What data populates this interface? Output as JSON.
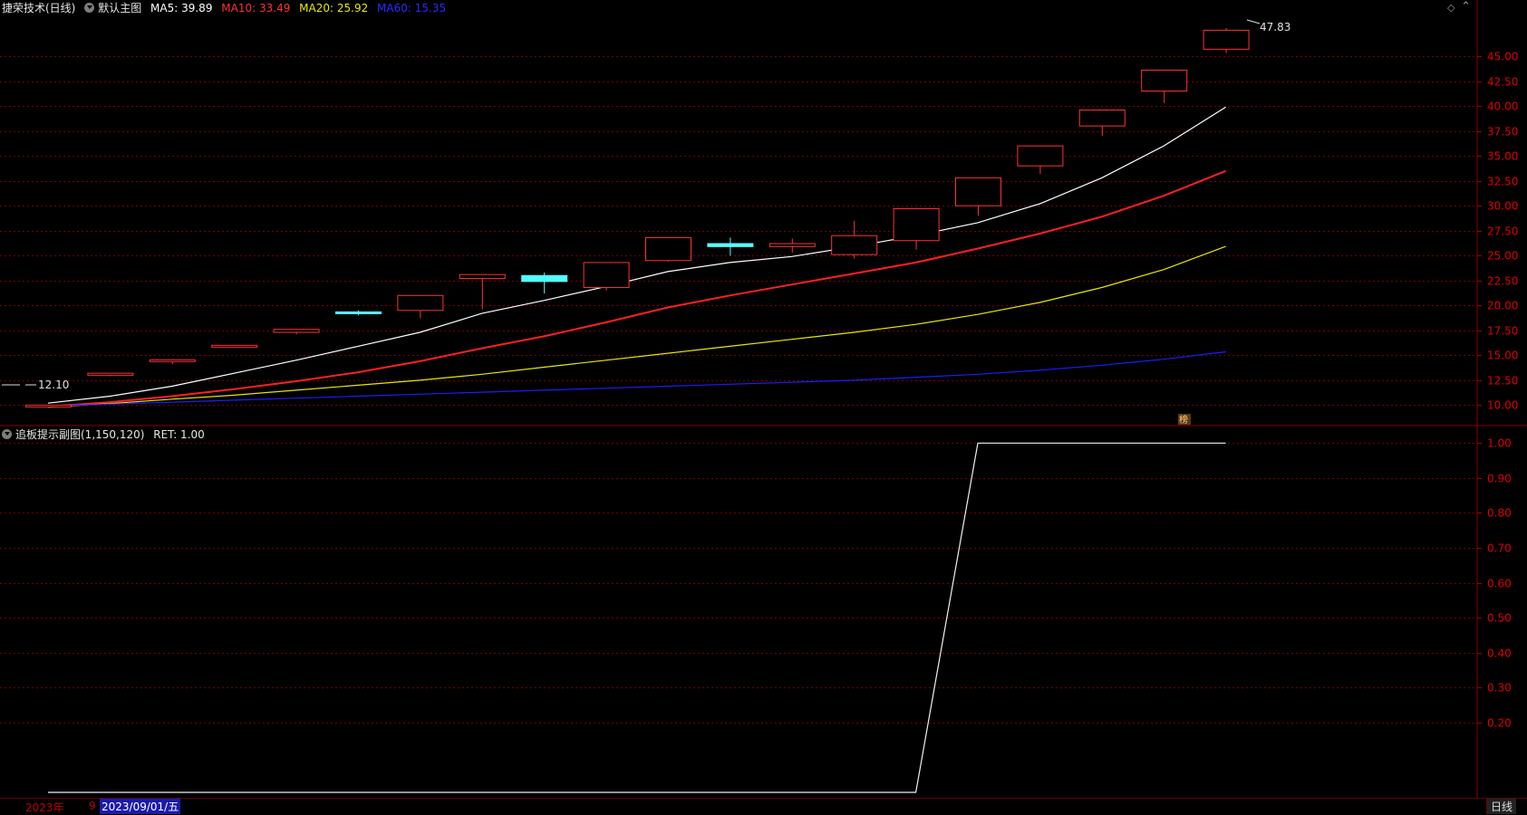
{
  "header": {
    "stock": "捷荣技术(日线)",
    "template": "默认主图",
    "ma5_label": "MA5: 39.89",
    "ma10_label": "MA10: 33.49",
    "ma20_label": "MA20: 25.92",
    "ma60_label": "MA60: 15.35"
  },
  "sub_header": {
    "indicator": "追板提示副图(1,150,120)",
    "ret_label": "RET: 1.00"
  },
  "annotations": {
    "high_marker": "47.83",
    "low_marker": "12.10",
    "badge": "榜"
  },
  "footer": {
    "year": "2023年",
    "month": "9",
    "cursor_date": "2023/09/01/五",
    "period": "日线"
  },
  "colors": {
    "up": "#ff3232",
    "down": "#54ffff",
    "ma5": "#ffffff",
    "ma10": "#ff2020",
    "ma20": "#e8e800",
    "ma60": "#1c1cff",
    "grid": "#7a0000"
  },
  "chart_data": [
    {
      "type": "candlestick",
      "ylim": [
        8.4,
        49.0
      ],
      "yticks": [
        10.0,
        12.5,
        15.0,
        17.5,
        20.0,
        22.5,
        25.0,
        27.5,
        30.0,
        32.5,
        35.0,
        37.5,
        40.0,
        42.5,
        45.0
      ],
      "ytick_labels": [
        "10.00",
        "12.50",
        "15.00",
        "17.50",
        "20.00",
        "22.50",
        "25.00",
        "27.50",
        "30.00",
        "32.50",
        "35.00",
        "37.50",
        "40.00",
        "42.50",
        "45.00"
      ],
      "candles": [
        {
          "o": 9.95,
          "h": 10.05,
          "l": 9.85,
          "c": 10.0
        },
        {
          "o": 13.0,
          "h": 13.2,
          "l": 12.9,
          "c": 13.2
        },
        {
          "o": 14.55,
          "h": 14.6,
          "l": 14.1,
          "c": 14.55
        },
        {
          "o": 16.0,
          "h": 16.05,
          "l": 15.95,
          "c": 16.0
        },
        {
          "o": 17.3,
          "h": 17.6,
          "l": 17.1,
          "c": 17.6
        },
        {
          "o": 19.35,
          "h": 19.5,
          "l": 19.0,
          "c": 19.2
        },
        {
          "o": 19.5,
          "h": 21.0,
          "l": 18.7,
          "c": 21.0
        },
        {
          "o": 22.7,
          "h": 23.1,
          "l": 19.6,
          "c": 23.1
        },
        {
          "o": 23.0,
          "h": 23.3,
          "l": 21.2,
          "c": 22.4
        },
        {
          "o": 21.8,
          "h": 24.3,
          "l": 21.5,
          "c": 24.3
        },
        {
          "o": 24.5,
          "h": 26.8,
          "l": 24.4,
          "c": 26.8
        },
        {
          "o": 26.2,
          "h": 26.8,
          "l": 25.0,
          "c": 25.9
        },
        {
          "o": 25.9,
          "h": 26.7,
          "l": 25.3,
          "c": 26.2
        },
        {
          "o": 25.1,
          "h": 28.5,
          "l": 24.7,
          "c": 27.0
        },
        {
          "o": 26.5,
          "h": 29.7,
          "l": 25.6,
          "c": 29.7
        },
        {
          "o": 30.0,
          "h": 32.8,
          "l": 29.0,
          "c": 32.8
        },
        {
          "o": 34.0,
          "h": 36.0,
          "l": 33.2,
          "c": 36.0
        },
        {
          "o": 38.0,
          "h": 39.6,
          "l": 37.0,
          "c": 39.6
        },
        {
          "o": 41.5,
          "h": 43.6,
          "l": 40.3,
          "c": 43.6
        },
        {
          "o": 45.7,
          "h": 47.83,
          "l": 45.3,
          "c": 47.6
        }
      ],
      "series": [
        {
          "name": "MA5",
          "values": [
            10.2,
            10.9,
            11.9,
            13.2,
            14.5,
            15.9,
            17.3,
            19.2,
            20.5,
            21.9,
            23.4,
            24.3,
            24.9,
            25.9,
            27.0,
            28.3,
            30.2,
            32.8,
            36.0,
            39.89
          ]
        },
        {
          "name": "MA10",
          "values": [
            9.85,
            10.3,
            10.9,
            11.6,
            12.4,
            13.3,
            14.4,
            15.7,
            16.9,
            18.3,
            19.8,
            21.0,
            22.1,
            23.2,
            24.3,
            25.7,
            27.2,
            28.9,
            31.0,
            33.49
          ]
        },
        {
          "name": "MA20",
          "values": [
            9.8,
            10.15,
            10.6,
            11.0,
            11.5,
            12.0,
            12.5,
            13.1,
            13.8,
            14.5,
            15.2,
            15.9,
            16.6,
            17.3,
            18.1,
            19.1,
            20.3,
            21.8,
            23.6,
            25.92
          ]
        },
        {
          "name": "MA60",
          "values": [
            9.9,
            10.1,
            10.3,
            10.5,
            10.7,
            10.9,
            11.1,
            11.3,
            11.5,
            11.7,
            11.9,
            12.1,
            12.3,
            12.5,
            12.8,
            13.1,
            13.5,
            14.0,
            14.6,
            15.35
          ]
        }
      ]
    },
    {
      "type": "line",
      "ylim": [
        0,
        1.05
      ],
      "yticks": [
        0.2,
        0.3,
        0.4,
        0.5,
        0.6,
        0.7,
        0.8,
        0.9,
        1.0
      ],
      "ytick_labels": [
        "0.20",
        "0.30",
        "0.40",
        "0.50",
        "0.60",
        "0.70",
        "0.80",
        "0.90",
        "1.00"
      ],
      "series": [
        {
          "name": "RET",
          "values": [
            0,
            0,
            0,
            0,
            0,
            0,
            0,
            0,
            0,
            0,
            0,
            0,
            0,
            0,
            0,
            1,
            1,
            1,
            1,
            1
          ]
        }
      ]
    }
  ]
}
